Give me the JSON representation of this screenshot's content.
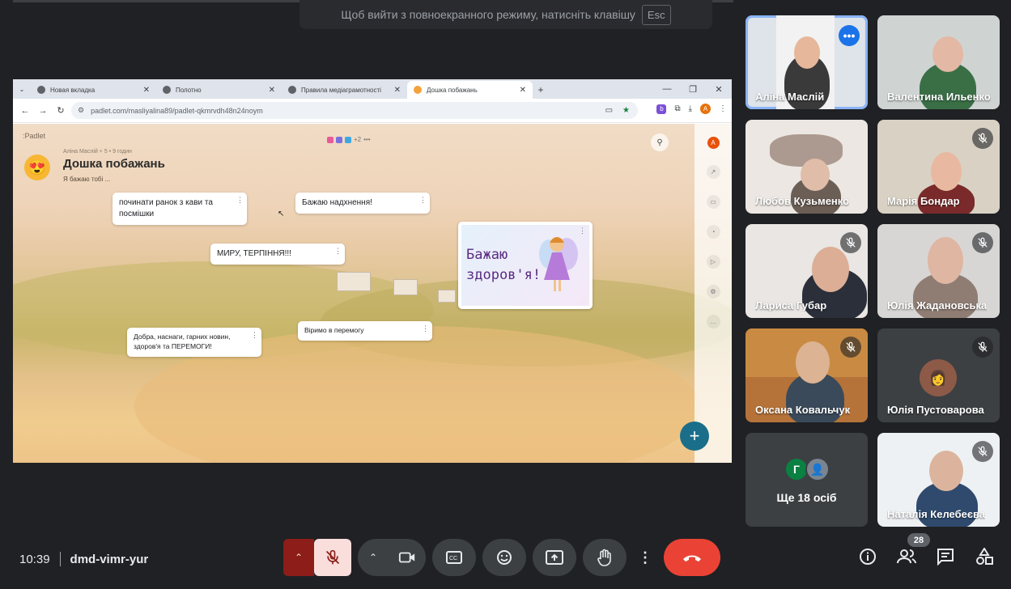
{
  "fullscreen_hint": {
    "text": "Щоб вийти з повноекранного режиму, натисніть клавішу",
    "key": "Esc"
  },
  "browser": {
    "tabs": [
      {
        "label": "Новая вкладка",
        "active": false
      },
      {
        "label": "Полотно",
        "active": false
      },
      {
        "label": "Правила медіаграмотності",
        "active": false
      },
      {
        "label": "Дошка побажань",
        "active": true
      }
    ],
    "url": "padlet.com/masliyalina89/padlet-qkmrvdh48n24noym",
    "profile_initial": "A",
    "extension_letter": "b"
  },
  "padlet": {
    "brand": ":Padlet",
    "meta": "Аліна Маслій + 5 • 9 годин",
    "title": "Дошка побажань",
    "description": "Я бажаю тобі ...",
    "presence_more": "+2",
    "side_avatar": "A",
    "posts": [
      {
        "text": "починати ранок з кави та посмішки"
      },
      {
        "text": "Бажаю надхнення!"
      },
      {
        "text": "МИРУ, ТЕРПІННЯ!!!"
      },
      {
        "text": "Добра, наснаги, гарних новин, здоров'я та ПЕРЕМОГИ!"
      },
      {
        "text": "Віримо в перемогу"
      }
    ],
    "image_post_text": [
      "Бажаю",
      "здоров'я!"
    ]
  },
  "participants": [
    {
      "name": "Аліна Маслій",
      "muted": false,
      "active_speaker": true
    },
    {
      "name": "Валентина Ильенко",
      "muted": false
    },
    {
      "name": "Любов Кузьменко",
      "muted": false
    },
    {
      "name": "Марія Бондар",
      "muted": true
    },
    {
      "name": "Лариса Губар",
      "muted": true
    },
    {
      "name": "Юлія Жадановська",
      "muted": true
    },
    {
      "name": "Оксана Ковальчук",
      "muted": true
    },
    {
      "name": "Юлія Пустоварова",
      "muted": true
    },
    {
      "name": "Наталія Келебеєва",
      "muted": true
    }
  ],
  "more_tile": {
    "label": "Ще 18 осіб",
    "avatar_letter": "Г"
  },
  "meeting": {
    "time": "10:39",
    "code": "dmd-vimr-yur",
    "participant_count": "28"
  },
  "colors": {
    "background": "#202124",
    "accent": "#8ab4f8",
    "hangup": "#ea4335",
    "mic_muted_bg": "#f9dedc"
  }
}
